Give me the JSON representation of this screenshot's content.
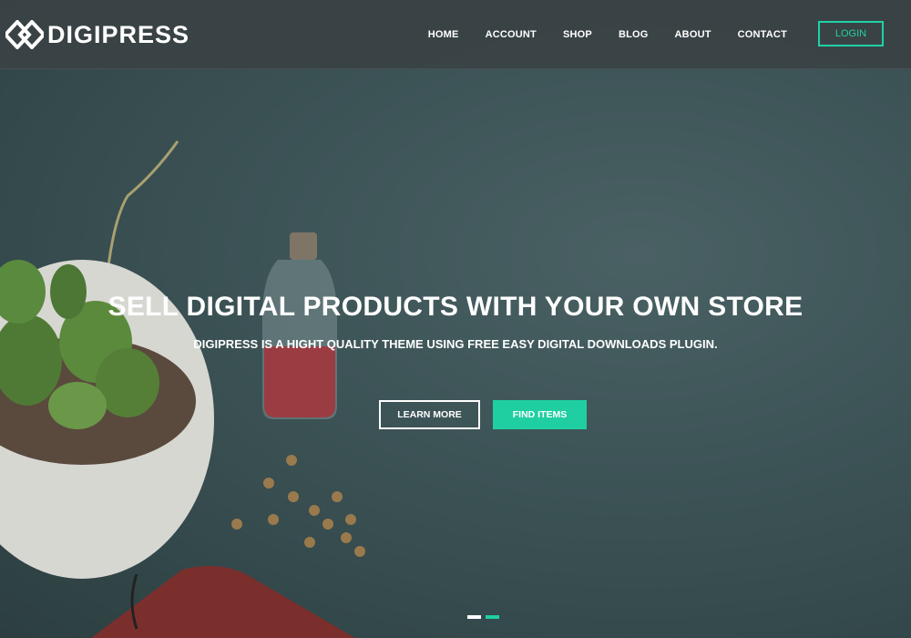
{
  "brand": {
    "name": "DIGIPRESS"
  },
  "nav": {
    "items": [
      "HOME",
      "ACCOUNT",
      "SHOP",
      "BLOG",
      "ABOUT",
      "CONTACT"
    ],
    "login_label": "LOGIN"
  },
  "hero": {
    "title": "SELL DIGITAL PRODUCTS WITH YOUR OWN STORE",
    "subtitle": "DIGIPRESS IS A HIGHT QUALITY THEME USING FREE EASY DIGITAL DOWNLOADS PLUGIN.",
    "primary_button": "LEARN MORE",
    "secondary_button": "FIND ITEMS"
  },
  "slider": {
    "dots": [
      {
        "color": "#ffffff",
        "active": false
      },
      {
        "color": "#1fcfa2",
        "active": true
      }
    ]
  },
  "colors": {
    "accent": "#1fcfa2",
    "header_bg": "#3a4244",
    "hero_bg": "#35494b"
  }
}
